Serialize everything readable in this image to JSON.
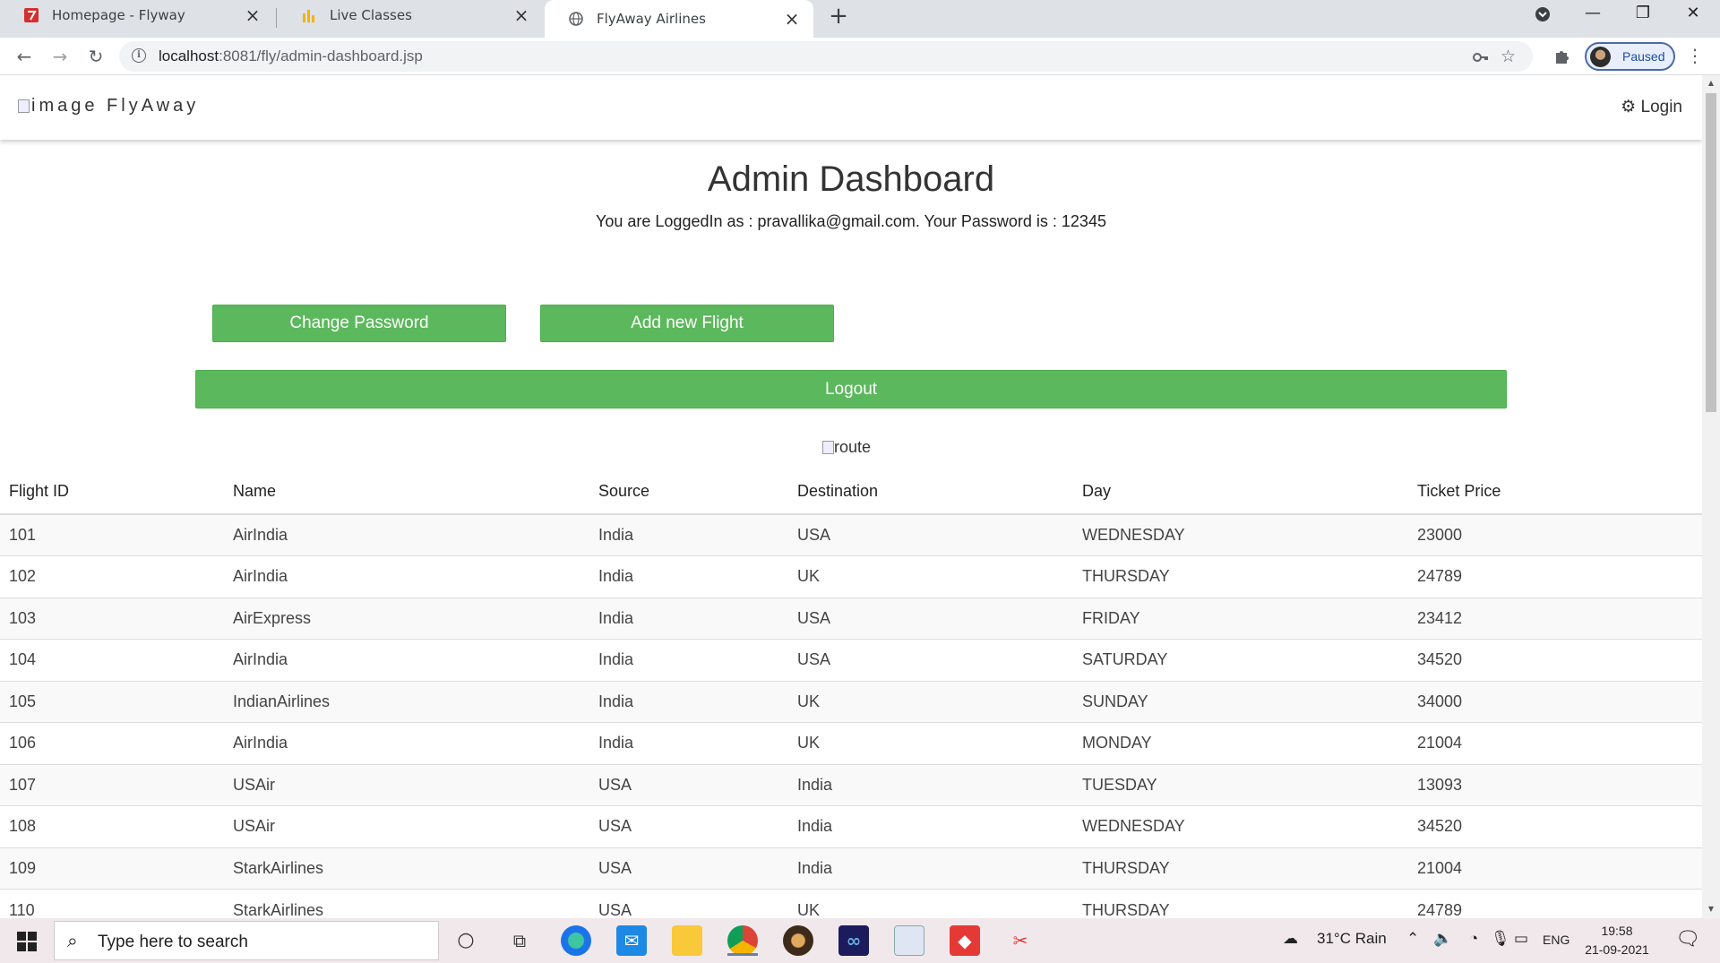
{
  "browser": {
    "tabs": [
      {
        "title": "Homepage - Flyway",
        "favicon": "flyway-logo-icon"
      },
      {
        "title": "Live Classes",
        "favicon": "bar-chart-icon"
      },
      {
        "title": "FlyAway Airlines",
        "favicon": "globe-icon",
        "active": true
      }
    ],
    "url_host": "localhost",
    "url_path": ":8081/fly/admin-dashboard.jsp",
    "profile_label": "Paused"
  },
  "site": {
    "brand_alt": "image",
    "brand_name": "FlyAway",
    "login_label": "Login",
    "title": "Admin Dashboard",
    "logged_in_text": "You are LoggedIn as : pravallika@gmail.com. Your Password is : 12345",
    "buttons": {
      "change_password": "Change Password",
      "add_flight": "Add new Flight",
      "logout": "Logout"
    },
    "route_alt": "route",
    "accent": "#5cb85c"
  },
  "table": {
    "headers": [
      "Flight ID",
      "Name",
      "Source",
      "Destination",
      "Day",
      "Ticket Price"
    ],
    "rows": [
      [
        "101",
        "AirIndia",
        "India",
        "USA",
        "WEDNESDAY",
        "23000"
      ],
      [
        "102",
        "AirIndia",
        "India",
        "UK",
        "THURSDAY",
        "24789"
      ],
      [
        "103",
        "AirExpress",
        "India",
        "USA",
        "FRIDAY",
        "23412"
      ],
      [
        "104",
        "AirIndia",
        "India",
        "USA",
        "SATURDAY",
        "34520"
      ],
      [
        "105",
        "IndianAirlines",
        "India",
        "UK",
        "SUNDAY",
        "34000"
      ],
      [
        "106",
        "AirIndia",
        "India",
        "UK",
        "MONDAY",
        "21004"
      ],
      [
        "107",
        "USAir",
        "USA",
        "India",
        "TUESDAY",
        "13093"
      ],
      [
        "108",
        "USAir",
        "USA",
        "India",
        "WEDNESDAY",
        "34520"
      ],
      [
        "109",
        "StarkAirlines",
        "USA",
        "India",
        "THURSDAY",
        "21004"
      ],
      [
        "110",
        "StarkAirlines",
        "USA",
        "UK",
        "THURSDAY",
        "24789"
      ]
    ]
  },
  "taskbar": {
    "search_placeholder": "Type here to search",
    "weather": "31°C  Rain",
    "language": "ENG",
    "time": "19:58",
    "date": "21-09-2021"
  }
}
